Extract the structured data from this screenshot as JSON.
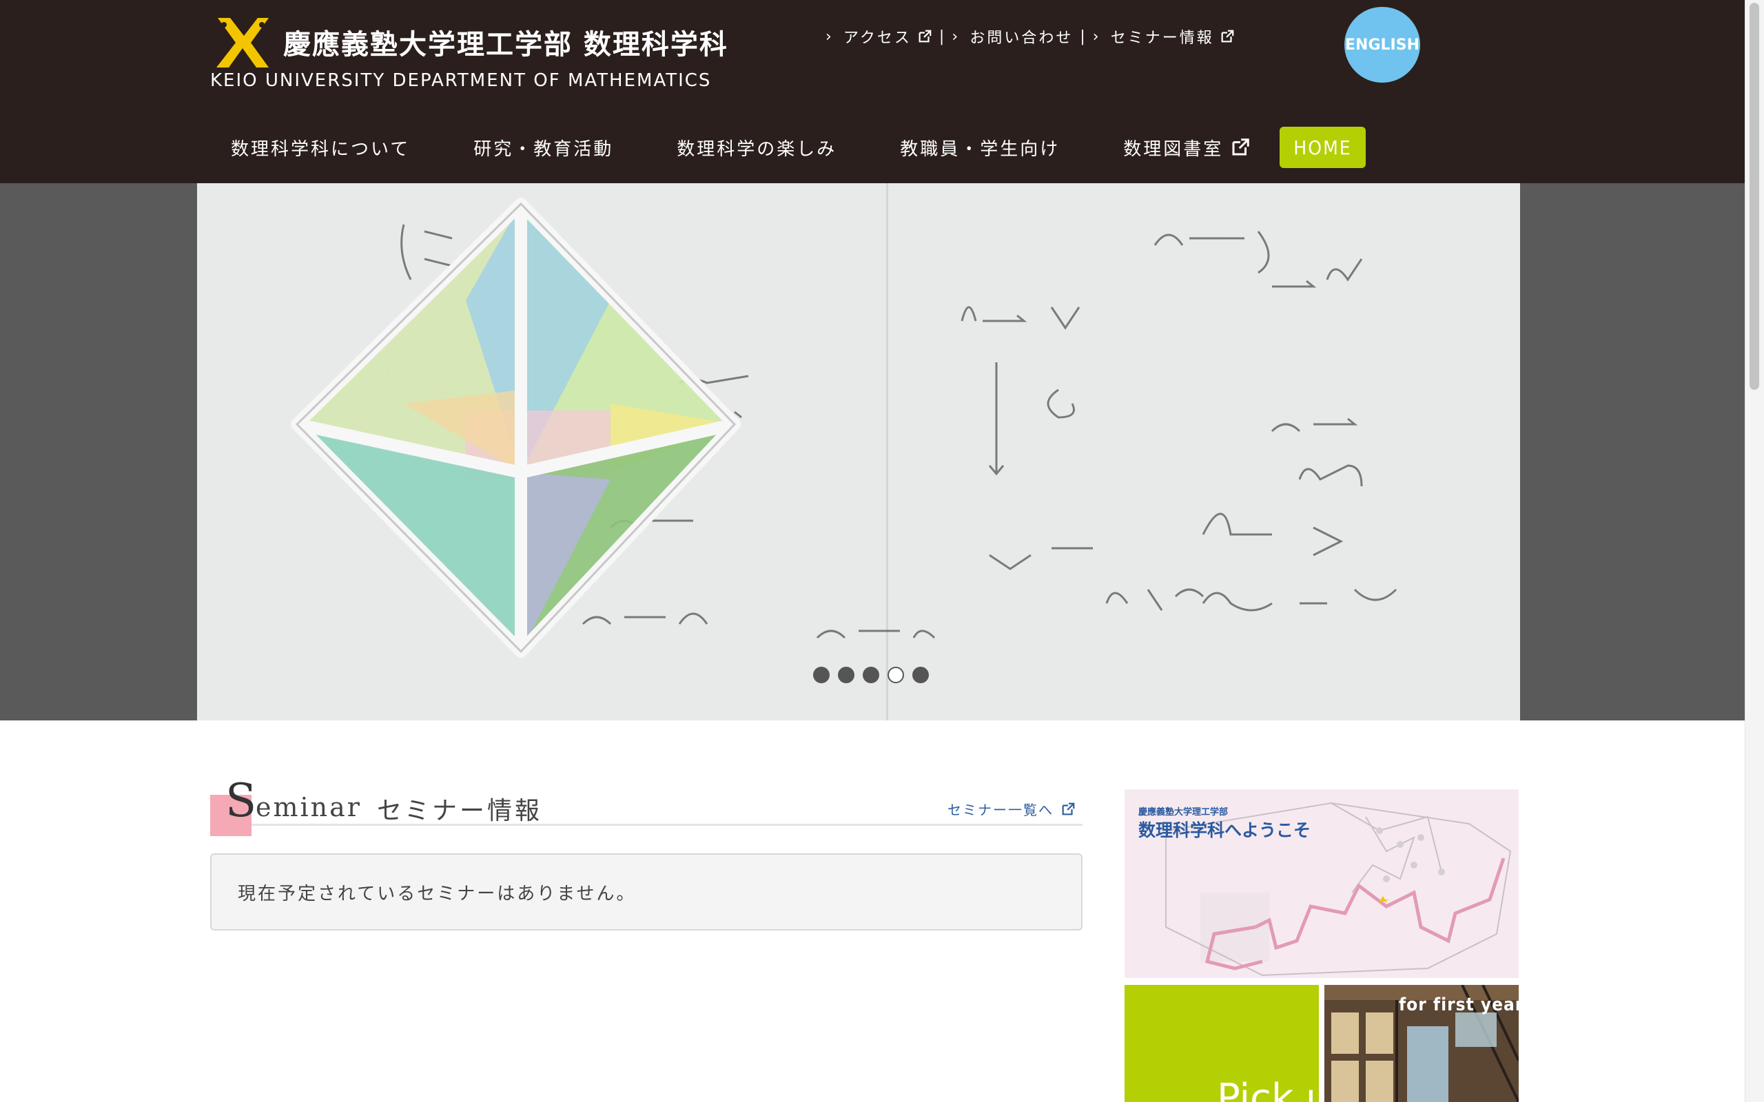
{
  "header": {
    "logo_jp": "慶應義塾大学理工学部 数理科学科",
    "logo_en": "KEIO UNIVERSITY  DEPARTMENT OF MATHEMATICS",
    "toplinks": [
      {
        "label": "アクセス",
        "external": true
      },
      {
        "label": "お問い合わせ",
        "external": false
      },
      {
        "label": "セミナー情報",
        "external": true
      }
    ],
    "english_label": "ENGLISH",
    "nav": [
      {
        "label": "数理科学科について"
      },
      {
        "label": "研究・教育活動"
      },
      {
        "label": "数理科学の楽しみ"
      },
      {
        "label": "教職員・学生向け"
      },
      {
        "label": "数理図書室",
        "external": true
      }
    ],
    "home_label": "HOME"
  },
  "hero": {
    "slides_total": 5,
    "active_slide": 4
  },
  "seminar": {
    "title_initial": "S",
    "title_rest": "eminar",
    "title_jp": "セミナー情報",
    "list_link": "セミナー一覧へ",
    "empty_message": "現在予定されているセミナーはありません。"
  },
  "sidebar": {
    "welcome_small": "慶應義塾大学理工学部",
    "welcome_big": "数理科学科へようこそ",
    "pickup_label": "Pick up",
    "firstyear_label": "for first year"
  },
  "colors": {
    "header_bg": "#2a1f1c",
    "accent_green": "#b5cf05",
    "english_blue": "#6fc3ee",
    "link_blue": "#2f5f9e",
    "seminar_pink": "#f4a9b5"
  }
}
